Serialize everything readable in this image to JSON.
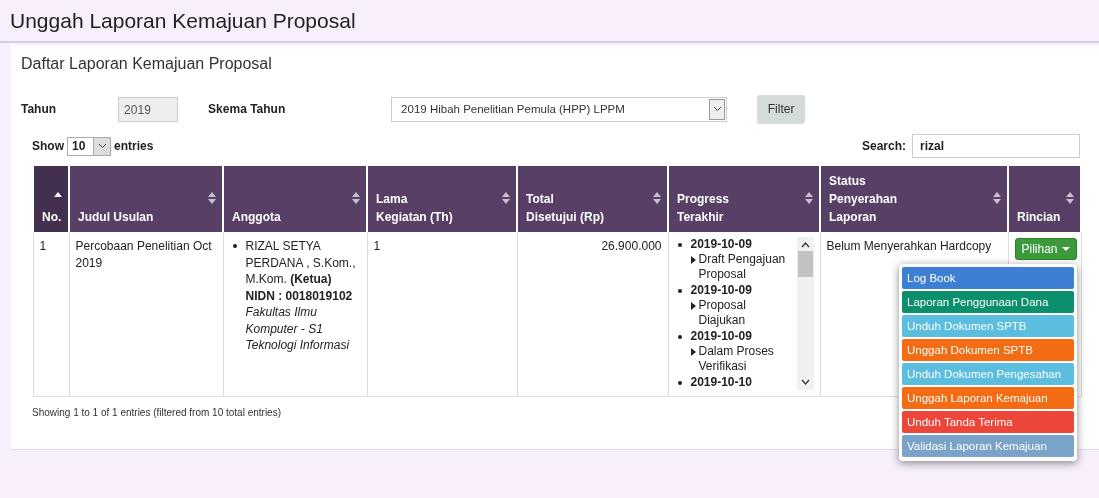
{
  "page_title": "Unggah Laporan Kemajuan Proposal",
  "panel": {
    "title": "Daftar Laporan Kemajuan Proposal",
    "filters": {
      "year_label": "Tahun",
      "year_value": "2019",
      "scheme_label": "Skema Tahun",
      "scheme_value": "2019 Hibah Penelitian Pemula (HPP) LPPM",
      "filter_button": "Filter"
    },
    "length": {
      "show": "Show",
      "value": "10",
      "entries": "entries"
    },
    "search": {
      "label": "Search:",
      "value": "rizal"
    },
    "table": {
      "columns": [
        {
          "label": "No.",
          "sorted": true
        },
        {
          "label": "Judul Usulan",
          "sorted": false
        },
        {
          "label": "Anggota",
          "sorted": false
        },
        {
          "label": "Lama Kegiatan (Th)",
          "sorted": false
        },
        {
          "label": "Total Disetujui (Rp)",
          "sorted": false
        },
        {
          "label": "Progress Terakhir",
          "sorted": false
        },
        {
          "label": "Status Penyerahan Laporan",
          "sorted": false
        },
        {
          "label": "Rincian",
          "sorted": false
        }
      ],
      "rows": [
        {
          "no": "1",
          "title": "Percobaan Penelitian Oct 2019",
          "members": [
            {
              "name": "RIZAL SETYA PERDANA , S.Kom., M.Kom. **(Ketua)**",
              "nidn": "NIDN : 0018019102",
              "faculty": "Fakultas Ilmu Komputer - S1 Teknologi Informasi"
            }
          ],
          "duration": "1",
          "total": "26.900.000",
          "progress": [
            {
              "date": "2019-10-09",
              "status": "Draft Pengajuan Proposal"
            },
            {
              "date": "2019-10-09",
              "status": "Proposal Diajukan"
            },
            {
              "date": "2019-10-09",
              "status": "Dalam Proses Verifikasi"
            },
            {
              "date": "2019-10-10"
            }
          ],
          "report_status": "Belum Menyerahkan Hardcopy",
          "action_button": "Pilihan",
          "menu": [
            {
              "label": "Log Book",
              "color": "#3e7fd6"
            },
            {
              "label": "Laporan Penggunaan Dana",
              "color": "#0c8f6c"
            },
            {
              "label": "Unduh Dokumen SPTB",
              "color": "#5bbede"
            },
            {
              "label": "Unggah Dokumen SPTB",
              "color": "#f36c14"
            },
            {
              "label": "Unduh Dokumen Pengesahan",
              "color": "#5bbede"
            },
            {
              "label": "Unggah Laporan Kemajuan",
              "color": "#f36c14"
            },
            {
              "label": "Unduh Tanda Terima",
              "color": "#ec463a"
            },
            {
              "label": "Validasi Laporan Kemajuan",
              "color": "#7aa3c9"
            }
          ]
        }
      ]
    },
    "info": "Showing 1 to 1 of 1 entries (filtered from 10 total entries)"
  }
}
